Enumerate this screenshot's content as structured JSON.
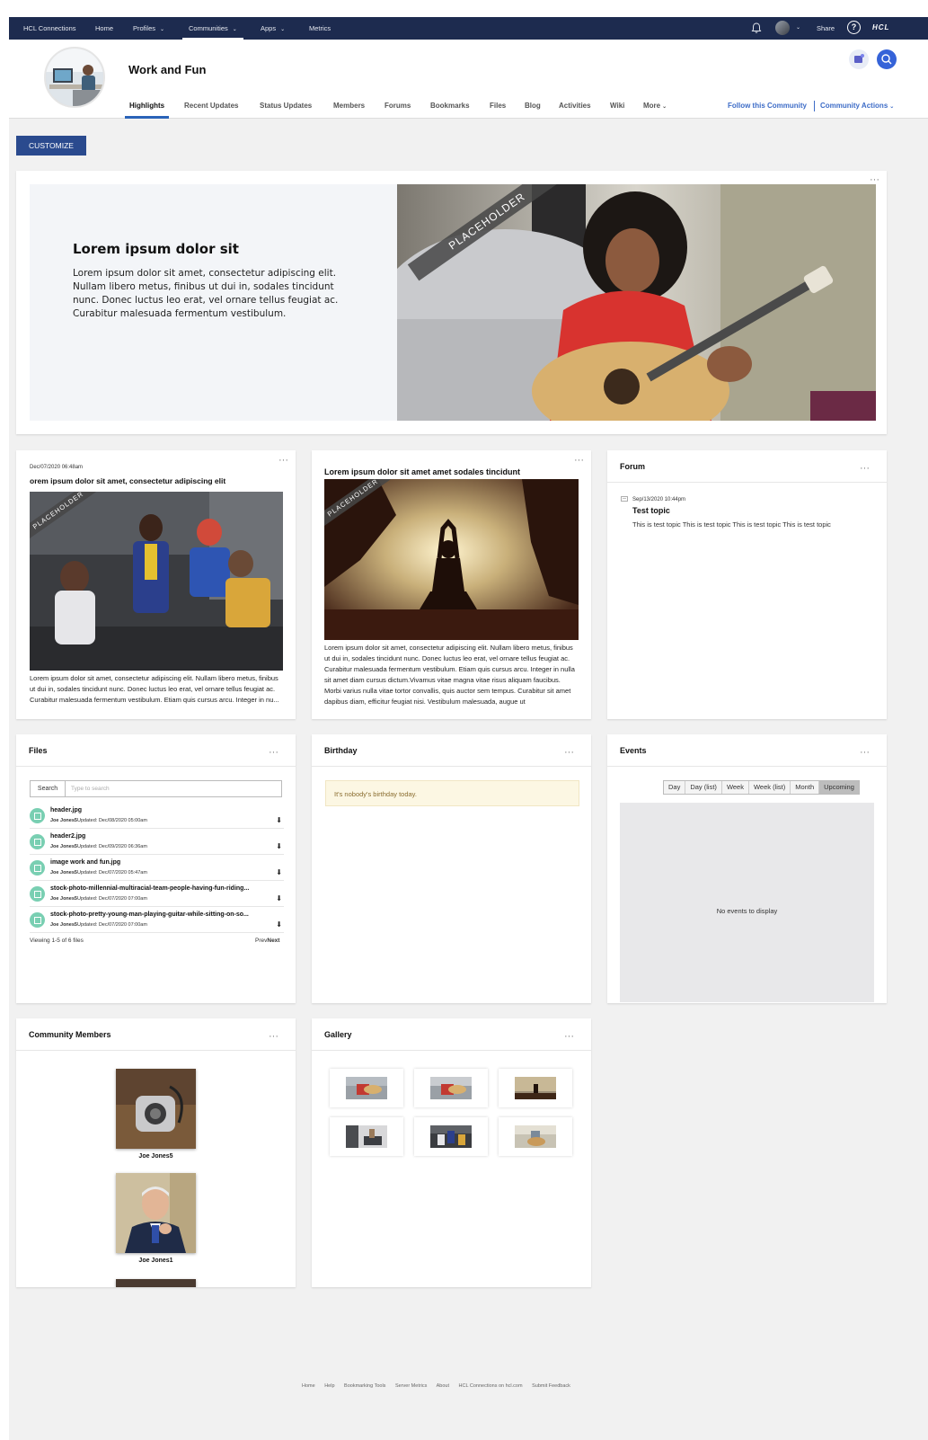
{
  "topnav": {
    "items": [
      "HCL Connections",
      "Home",
      "Profiles",
      "Communities",
      "Apps",
      "Metrics"
    ],
    "share": "Share",
    "help": "?",
    "logo": "HCL"
  },
  "community": {
    "title": "Work and Fun",
    "tabs": [
      "Highlights",
      "Recent Updates",
      "Status Updates",
      "Members",
      "Forums",
      "Bookmarks",
      "Files",
      "Blog",
      "Activities",
      "Wiki",
      "More"
    ],
    "follow": "Follow this Community",
    "actions": "Community Actions"
  },
  "customize_label": "CUSTOMIZE",
  "banner": {
    "heading": "Lorem ipsum dolor sit",
    "text": "Lorem ipsum dolor sit amet, consectetur adipiscing elit. Nullam libero metus, finibus ut dui in, sodales tincidunt nunc. Donec luctus leo erat, vel ornare tellus feugiat ac. Curabitur malesuada fermentum vestibulum.",
    "ribbon": "PLACEHOLDER"
  },
  "post1": {
    "date": "Dec/07/2020 06:48am",
    "title": "orem ipsum dolor sit amet, consectetur adipiscing elit",
    "ribbon": "PLACEHOLDER",
    "text": "Lorem ipsum dolor sit amet, consectetur adipiscing elit. Nullam libero metus, finibus ut dui in, sodales tincidunt nunc. Donec luctus leo erat, vel ornare tellus feugiat ac. Curabitur malesuada fermentum vestibulum. Etiam quis cursus arcu. Integer in nu..."
  },
  "post2": {
    "title": "Lorem ipsum dolor sit amet amet sodales tincidunt",
    "ribbon": "PLACEHOLDER",
    "text": "Lorem ipsum dolor sit amet, consectetur adipiscing elit. Nullam libero metus, finibus ut dui in, sodales tincidunt nunc. Donec luctus leo erat, vel ornare tellus feugiat ac. Curabitur malesuada fermentum vestibulum. Etiam quis cursus arcu. Integer in nulla sit amet diam cursus dictum.Vivamus vitae magna vitae risus aliquam faucibus. Morbi varius nulla vitae tortor convallis, quis auctor sem tempus. Curabitur sit amet dapibus diam, efficitur feugiat nisi. Vestibulum malesuada, augue ut"
  },
  "forum": {
    "title": "Forum",
    "date": "Sep/13/2020 10:44pm",
    "topic": "Test topic",
    "text": "This is test topic This is test topic This is test topic This is test topic"
  },
  "files": {
    "title": "Files",
    "search_label": "Search",
    "search_placeholder": "Type to search",
    "rows": [
      {
        "name": "header.jpg",
        "author": "Joe Jones5",
        "updated": "Updated: Dec/08/2020 05:00am"
      },
      {
        "name": "header2.jpg",
        "author": "Joe Jones5",
        "updated": "Updated: Dec/09/2020 06:36am"
      },
      {
        "name": "image work and fun.jpg",
        "author": "Joe Jones5",
        "updated": "Updated: Dec/07/2020 05:47am"
      },
      {
        "name": "stock-photo-millennial-multiracial-team-people-having-fun-riding...",
        "author": "Joe Jones5",
        "updated": "Updated: Dec/07/2020 07:00am"
      },
      {
        "name": "stock-photo-pretty-young-man-playing-guitar-while-sitting-on-so...",
        "author": "Joe Jones5",
        "updated": "Updated: Dec/07/2020 07:00am"
      }
    ],
    "paging": "Viewing 1-5 of 6 files",
    "prev": "Prev",
    "next": "Next"
  },
  "birthday": {
    "title": "Birthday",
    "message": "It's nobody's birthday today."
  },
  "events": {
    "title": "Events",
    "buttons": [
      "Day",
      "Day (list)",
      "Week",
      "Week (list)",
      "Month",
      "Upcoming"
    ],
    "empty": "No events to display"
  },
  "members": {
    "title": "Community Members",
    "people": [
      "Joe Jones5",
      "Joe Jones1"
    ]
  },
  "gallery": {
    "title": "Gallery"
  },
  "footer": [
    "Home",
    "Help",
    "Bookmarking Tools",
    "Server Metrics",
    "About",
    "HCL Connections on hcl.com",
    "Submit Feedback"
  ]
}
